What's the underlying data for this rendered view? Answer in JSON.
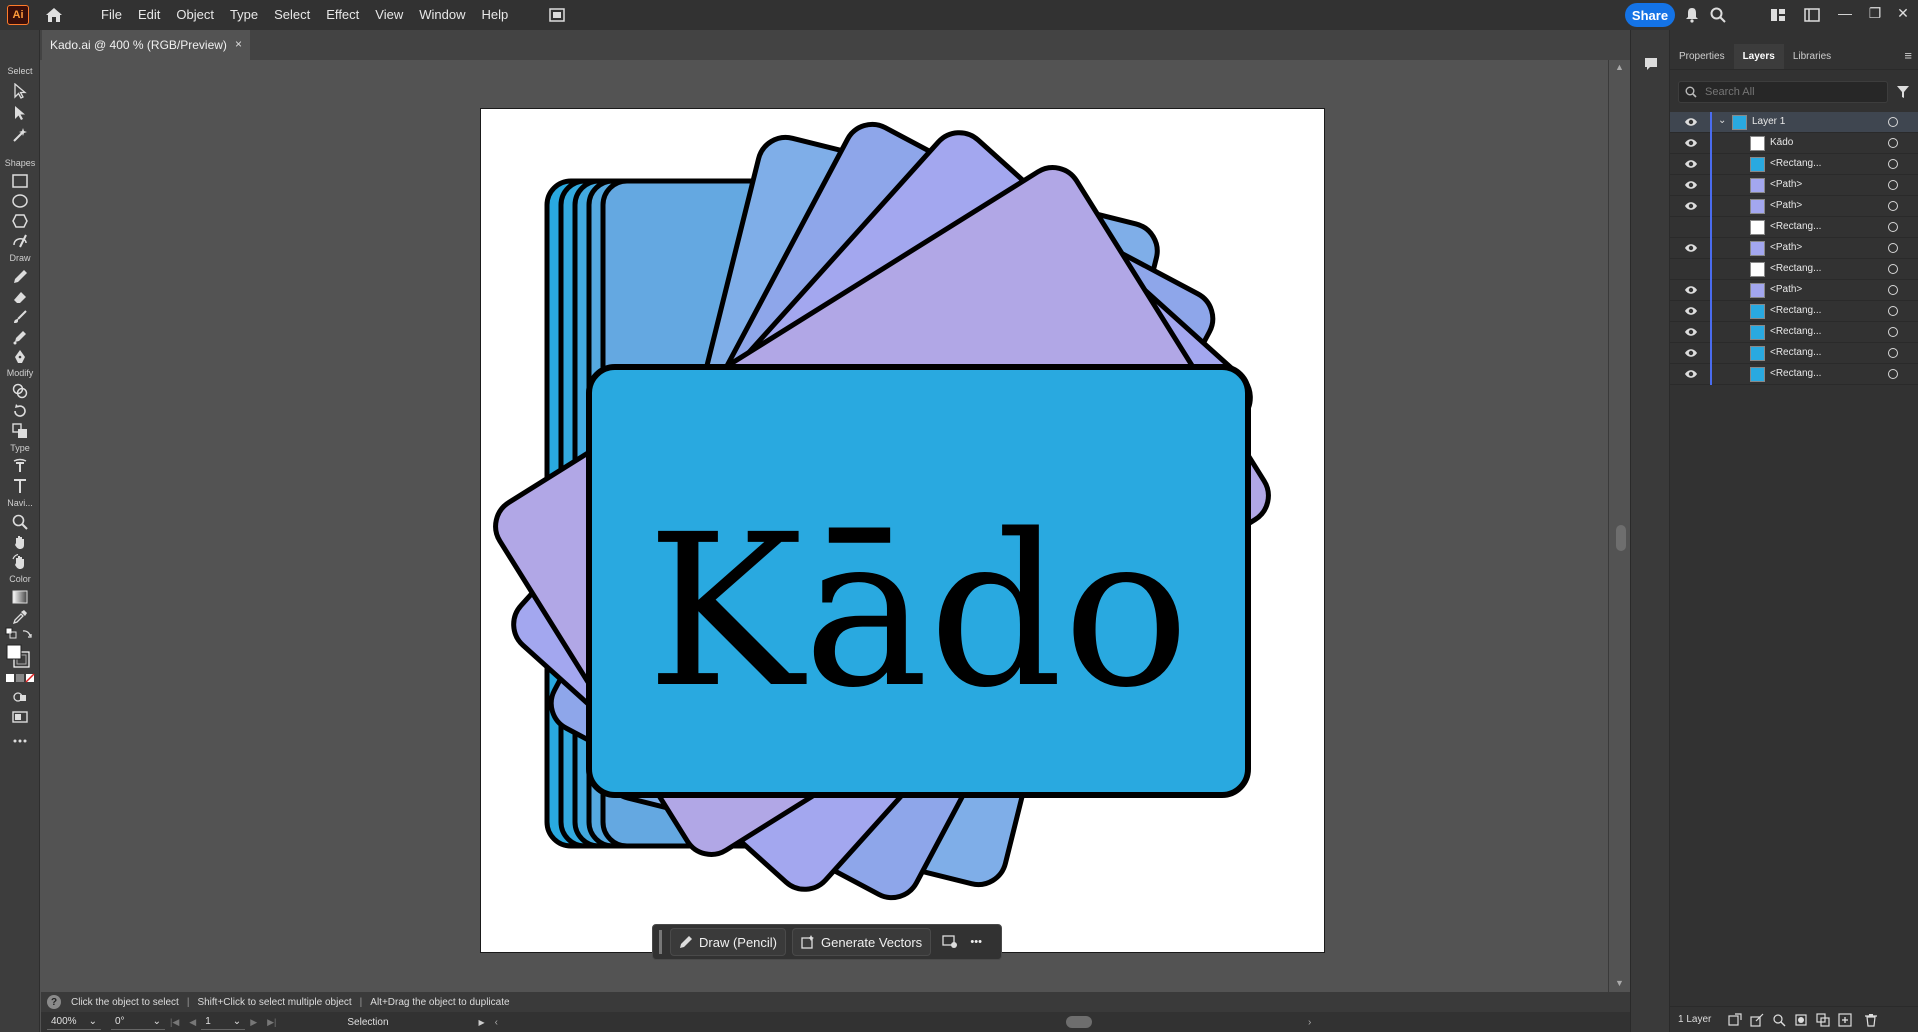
{
  "app": {
    "logo_text": "Ai"
  },
  "menu": [
    "File",
    "Edit",
    "Object",
    "Type",
    "Select",
    "Effect",
    "View",
    "Window",
    "Help"
  ],
  "topbar": {
    "share_label": "Share",
    "window_controls": [
      "—",
      "❐",
      "✕"
    ]
  },
  "document": {
    "tab_title": "Kado.ai @ 400 % (RGB/Preview)",
    "close_glyph": "×"
  },
  "toolbar": {
    "categories": [
      "Select",
      "Shapes",
      "Draw",
      "Modify",
      "Type",
      "Navi...",
      "Color"
    ]
  },
  "artwork": {
    "title_text": "Kādo",
    "colors": {
      "front_card": "#29a9e0",
      "stack_cards": [
        "#29a9e0",
        "#33abe0",
        "#42aae0",
        "#55a9e0",
        "#64a8e1"
      ],
      "fan_cards": [
        "#7faee8",
        "#8ea6ea",
        "#a3a7ef",
        "#b1a7e6"
      ],
      "outline": "#000000"
    }
  },
  "taskbar": {
    "draw_label": "Draw (Pencil)",
    "generate_label": "Generate Vectors",
    "more_glyph": "•••"
  },
  "hint": {
    "part1": "Click the object to select",
    "part2": "Shift+Click to select multiple object",
    "part3": "Alt+Drag the object to duplicate"
  },
  "status": {
    "zoom": "400%",
    "rotation": "0°",
    "artboard": "1",
    "mode": "Selection"
  },
  "panel": {
    "tabs": [
      "Properties",
      "Layers",
      "Libraries"
    ],
    "active_tab": "Layers",
    "search_placeholder": "Search All",
    "layer_count": "1 Layer",
    "layers": [
      {
        "name": "Layer 1",
        "visible": true,
        "kind": "layer"
      },
      {
        "name": "Kādo",
        "visible": true,
        "kind": "text"
      },
      {
        "name": "<Rectang...",
        "visible": true,
        "kind": "rect-blue"
      },
      {
        "name": "<Path>",
        "visible": true,
        "kind": "path"
      },
      {
        "name": "<Path>",
        "visible": true,
        "kind": "path"
      },
      {
        "name": "<Rectang...",
        "visible": false,
        "kind": "rect-white"
      },
      {
        "name": "<Path>",
        "visible": true,
        "kind": "path"
      },
      {
        "name": "<Rectang...",
        "visible": false,
        "kind": "rect-white"
      },
      {
        "name": "<Path>",
        "visible": true,
        "kind": "path"
      },
      {
        "name": "<Rectang...",
        "visible": true,
        "kind": "rect-blue"
      },
      {
        "name": "<Rectang...",
        "visible": true,
        "kind": "rect-blue"
      },
      {
        "name": "<Rectang...",
        "visible": true,
        "kind": "rect-blue"
      },
      {
        "name": "<Rectang...",
        "visible": true,
        "kind": "rect-blue"
      }
    ]
  }
}
